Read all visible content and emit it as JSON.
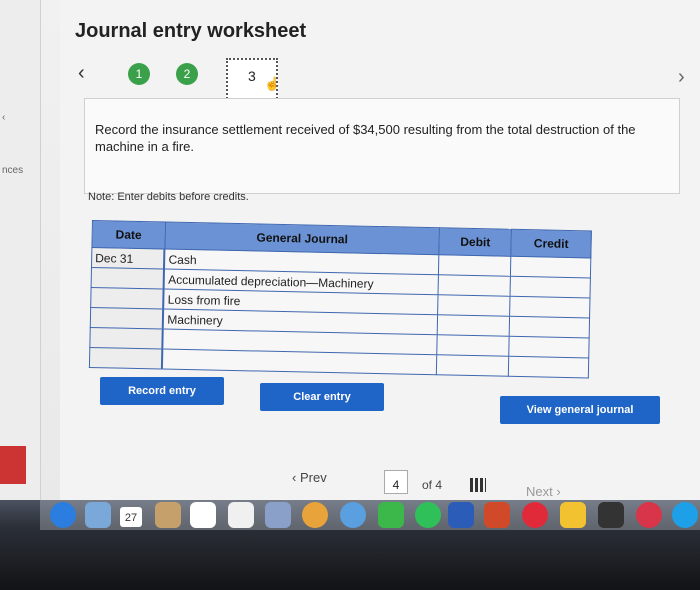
{
  "page": {
    "title": "Journal entry worksheet"
  },
  "sidebar": {
    "partial_text": "nces"
  },
  "steps": {
    "prev_icon": "chevron-left-icon",
    "items": [
      "1",
      "2",
      "3"
    ],
    "current": 3,
    "next_icon": "chevron-right-icon"
  },
  "instruction": "Record the insurance settlement received of $34,500 resulting from the total destruction of the machine in a fire.",
  "note": "Note: Enter debits before credits.",
  "journal": {
    "headers": {
      "date": "Date",
      "account": "General Journal",
      "debit": "Debit",
      "credit": "Credit"
    },
    "rows": [
      {
        "date": "Dec 31",
        "account": "Cash",
        "debit": "",
        "credit": ""
      },
      {
        "date": "",
        "account": "Accumulated depreciation—Machinery",
        "debit": "",
        "credit": ""
      },
      {
        "date": "",
        "account": "Loss from fire",
        "debit": "",
        "credit": ""
      },
      {
        "date": "",
        "account": "Machinery",
        "debit": "",
        "credit": ""
      },
      {
        "date": "",
        "account": "",
        "debit": "",
        "credit": ""
      },
      {
        "date": "",
        "account": "",
        "debit": "",
        "credit": ""
      }
    ]
  },
  "buttons": {
    "record": "Record entry",
    "clear": "Clear entry",
    "view": "View general journal"
  },
  "pagination": {
    "prev": "Prev",
    "page": "4",
    "of": "of 4",
    "next": "Next"
  },
  "dock": {
    "calendar_month": "OCT",
    "calendar_day": "27"
  },
  "colors": {
    "header_blue": "#6b92d4",
    "button_blue": "#1f64c7",
    "step_green": "#3aa14a"
  }
}
